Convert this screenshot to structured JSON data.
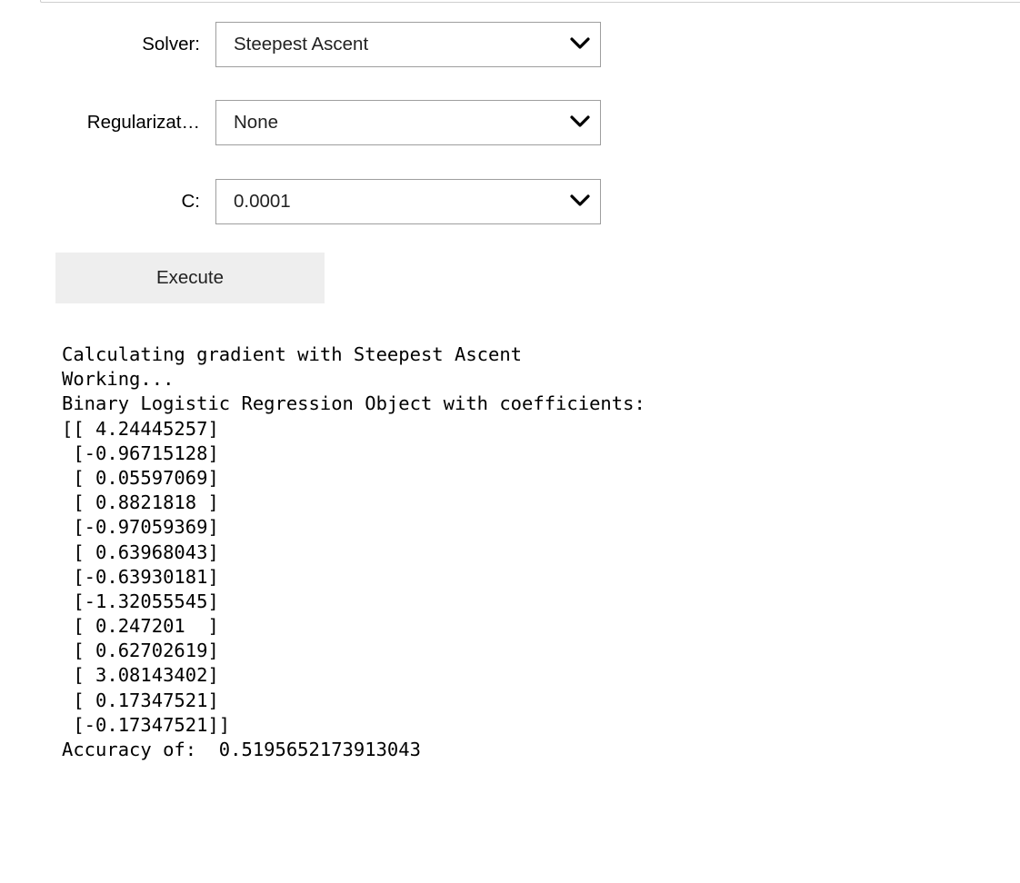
{
  "form": {
    "solver": {
      "label": "Solver:",
      "value": "Steepest Ascent"
    },
    "regularization": {
      "label": "Regularizat…",
      "value": "None"
    },
    "c": {
      "label": "C:",
      "value": "0.0001"
    },
    "execute_label": "Execute"
  },
  "icons": {
    "dropdown": "chevron-down-icon"
  },
  "output": {
    "lines": [
      "Calculating gradient with Steepest Ascent",
      "Working...",
      "Binary Logistic Regression Object with coefficients:",
      "[[ 4.24445257]",
      " [-0.96715128]",
      " [ 0.05597069]",
      " [ 0.8821818 ]",
      " [-0.97059369]",
      " [ 0.63968043]",
      " [-0.63930181]",
      " [-1.32055545]",
      " [ 0.247201  ]",
      " [ 0.62702619]",
      " [ 3.08143402]",
      " [ 0.17347521]",
      " [-0.17347521]]",
      "Accuracy of:  0.5195652173913043"
    ]
  }
}
